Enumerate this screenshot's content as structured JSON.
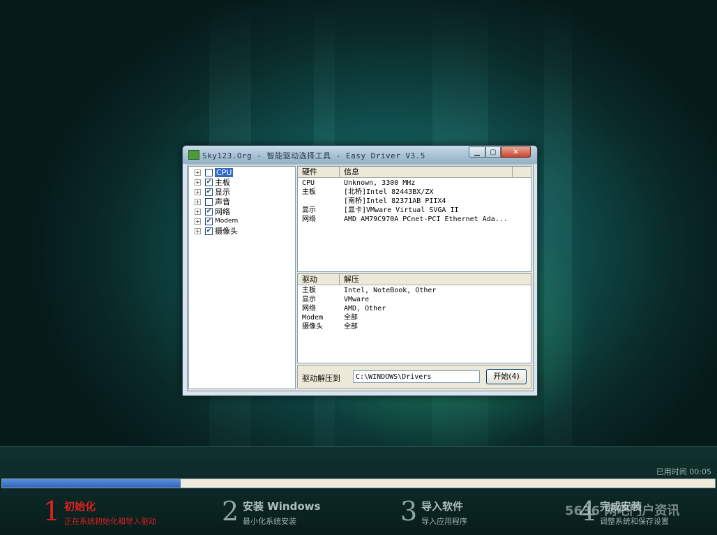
{
  "window": {
    "title": "Sky123.Org - 智能驱动选择工具 - Easy Driver V3.5",
    "min_symbol": "▁",
    "max_symbol": "▢",
    "close_symbol": "✕"
  },
  "tree": {
    "expander": "+",
    "items": [
      {
        "label": "CPU",
        "checked": false,
        "selected": true
      },
      {
        "label": "主板",
        "checked": true
      },
      {
        "label": "显示",
        "checked": true
      },
      {
        "label": "声音",
        "checked": false
      },
      {
        "label": "网络",
        "checked": true
      },
      {
        "label": "Modem",
        "checked": true
      },
      {
        "label": "摄像头",
        "checked": true
      }
    ]
  },
  "hardware": {
    "columns": [
      "硬件",
      "信息"
    ],
    "rows": [
      {
        "type": "CPU",
        "info": "Unknown, 3300 MHz"
      },
      {
        "type": "主板",
        "info": "[北桥]Intel 82443BX/ZX"
      },
      {
        "type": "",
        "info": "[南桥]Intel 82371AB PIIX4"
      },
      {
        "type": "显示",
        "info": "[显卡]VMware Virtual SVGA II"
      },
      {
        "type": "网络",
        "info": "AMD AM79C970A PCnet-PCI Ethernet Ada..."
      }
    ]
  },
  "drivers": {
    "columns": [
      "驱动",
      "解压"
    ],
    "rows": [
      {
        "type": "主板",
        "value": "Intel, NoteBook, Other"
      },
      {
        "type": "显示",
        "value": "VMware"
      },
      {
        "type": "网络",
        "value": "AMD, Other"
      },
      {
        "type": "Modem",
        "value": "全部"
      },
      {
        "type": "摄像头",
        "value": "全部"
      }
    ]
  },
  "extract": {
    "label": "驱动解压到",
    "path": "C:\\WINDOWS\\Drivers",
    "start_button": "开始(4)"
  },
  "footer": {
    "elapsed": "已用时间 00:05",
    "progress_fraction": 0.25,
    "steps": [
      {
        "num": "1",
        "title": "初始化",
        "sub": "正在系统初始化和导入驱动",
        "active": true
      },
      {
        "num": "2",
        "title": "安装 Windows",
        "sub": "最小化系统安装"
      },
      {
        "num": "3",
        "title": "导入软件",
        "sub": "导入应用程序"
      },
      {
        "num": "4",
        "title": "完成安装",
        "sub": "调整系统和保存设置"
      }
    ],
    "watermark": "5636 网吧门户资讯"
  },
  "colors": {
    "active_step": "#e02020",
    "progress": "#2f64bd",
    "selection": "#316ac5"
  }
}
